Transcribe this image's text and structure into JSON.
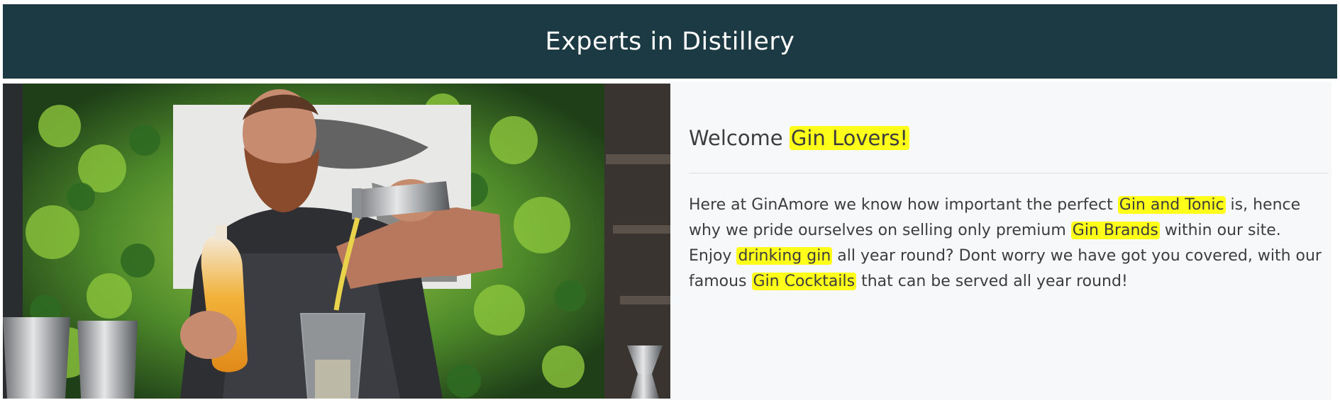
{
  "header": {
    "title": "Experts in Distillery"
  },
  "hero": {
    "image_description": "bartender-pouring-gin-icon"
  },
  "intro": {
    "heading_prefix": "Welcome ",
    "heading_highlight": "Gin Lovers!",
    "paragraph": {
      "part1": "Here at GinAmore we know how important the perfect ",
      "link1": "Gin and Tonic",
      "part2": " is, hence why we pride ourselves on selling only premium ",
      "link2": "Gin Brands",
      "part3": " within our site. Enjoy ",
      "link3": "drinking gin",
      "part4": " all year round? Dont worry we have got you covered, with our famous ",
      "link4": "Gin Cocktails",
      "part5": " that can be served all year round!"
    }
  },
  "colors": {
    "banner_bg": "#1c3a44",
    "highlight": "#ffff19",
    "content_bg": "#f7f8f9",
    "text": "#3d3d3d"
  }
}
